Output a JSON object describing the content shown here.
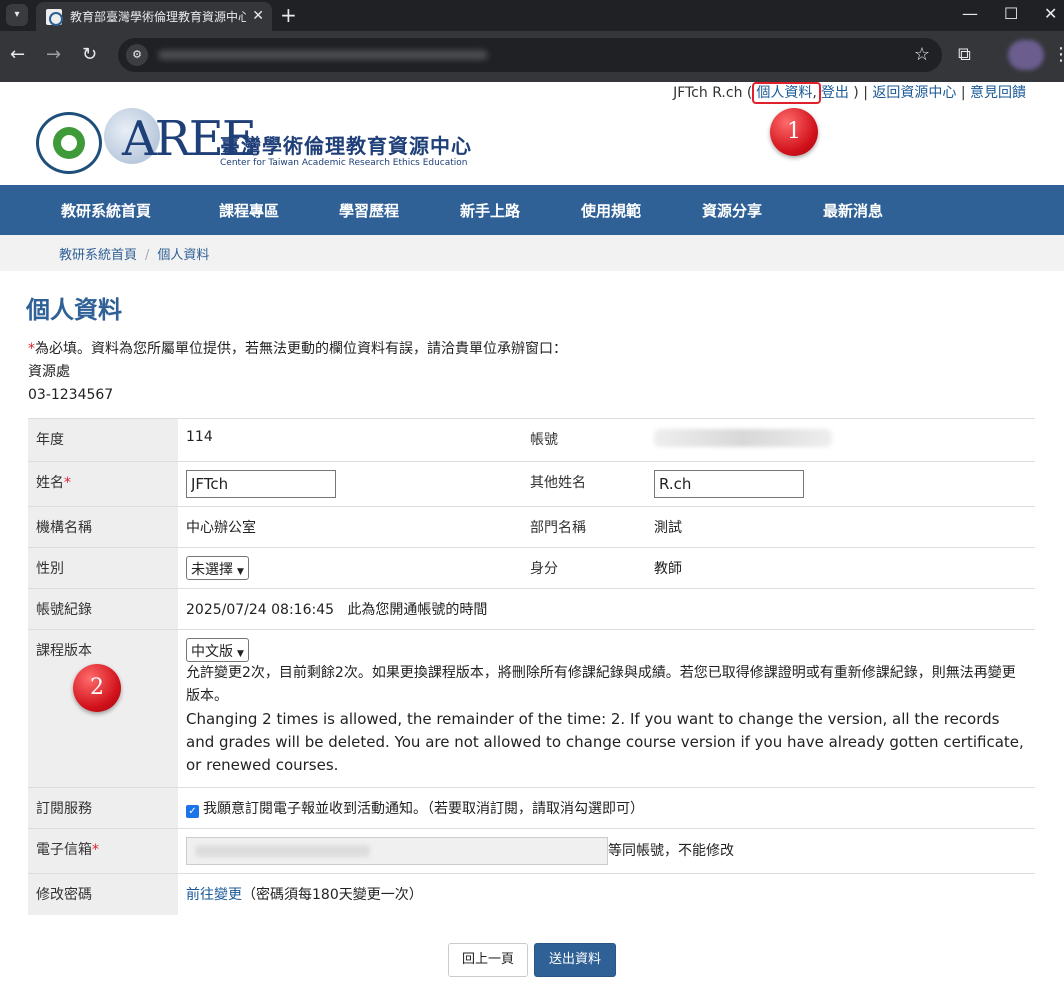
{
  "browser": {
    "tab_title": "教育部臺灣學術倫理教育資源中心",
    "tab_menu_icon": "chevron-down-icon",
    "new_tab_glyph": "+",
    "close_glyph": "✕",
    "minimize_glyph": "—",
    "maximize_glyph": "☐",
    "win_close_glyph": "✕"
  },
  "userbar": {
    "user_name": "JFTch R.ch",
    "open_paren": " (",
    "profile_link": "個人資料",
    "comma": ",",
    "logout_link": "登出",
    "close_paren": " ) | ",
    "back_link": "返回資源中心",
    "sep": " | ",
    "feedback_link": "意見回饋"
  },
  "logo": {
    "mark": "AREE",
    "name_cn": "臺灣學術倫理教育資源中心",
    "name_en": "Center for Taiwan Academic Research Ethics Education"
  },
  "nav": {
    "items": [
      "教研系統首頁",
      "課程專區",
      "學習歷程",
      "新手上路",
      "使用規範",
      "資源分享",
      "最新消息"
    ]
  },
  "breadcrumb": {
    "home": "教研系統首頁",
    "sep": "/",
    "current": "個人資料"
  },
  "page": {
    "title": "個人資料",
    "notice_star": "*",
    "notice_text": "為必填。資料為您所屬單位提供，若無法更動的欄位資料有誤，請洽貴單位承辦窗口：",
    "contact_unit": "資源處",
    "contact_phone": "03-1234567"
  },
  "form": {
    "year_label": "年度",
    "year_value": "114",
    "account_label": "帳號",
    "name_label": "姓名",
    "required_star": "*",
    "name_value": "JFTch",
    "other_name_label": "其他姓名",
    "other_name_value": "R.ch",
    "org_label": "機構名稱",
    "org_value": "中心辦公室",
    "dept_label": "部門名稱",
    "dept_value": "測試",
    "gender_label": "性別",
    "gender_selected": "未選擇",
    "identity_label": "身分",
    "identity_value": "教師",
    "account_log_label": "帳號紀錄",
    "account_log_time": "2025/07/24 08:16:45",
    "account_log_note": "此為您開通帳號的時間",
    "version_label": "課程版本",
    "version_selected": "中文版",
    "version_note_cn": "允許變更2次，目前剩餘2次。如果更換課程版本，將刪除所有修課紀錄與成績。若您已取得修課證明或有重新修課紀錄，則無法再變更版本。",
    "version_note_en": "Changing 2 times is allowed, the remainder of the time: 2. If you want to change the version, all the records and grades will be deleted. You are not allowed to change course version if you have already gotten certificate, or renewed courses.",
    "subscribe_label": "訂閱服務",
    "subscribe_text": "我願意訂閱電子報並收到活動通知。（若要取消訂閱，請取消勾選即可）",
    "email_label": "電子信箱",
    "email_note": "等同帳號，不能修改",
    "password_label": "修改密碼",
    "password_link": "前往變更",
    "password_note": "（密碼須每180天變更一次）"
  },
  "markers": {
    "one": "1",
    "two": "2"
  },
  "buttons": {
    "back": "回上一頁",
    "submit": "送出資料"
  },
  "colors": {
    "nav_blue": "#2f6196",
    "required_red": "#e0212b",
    "link_blue": "#1a5a96"
  }
}
